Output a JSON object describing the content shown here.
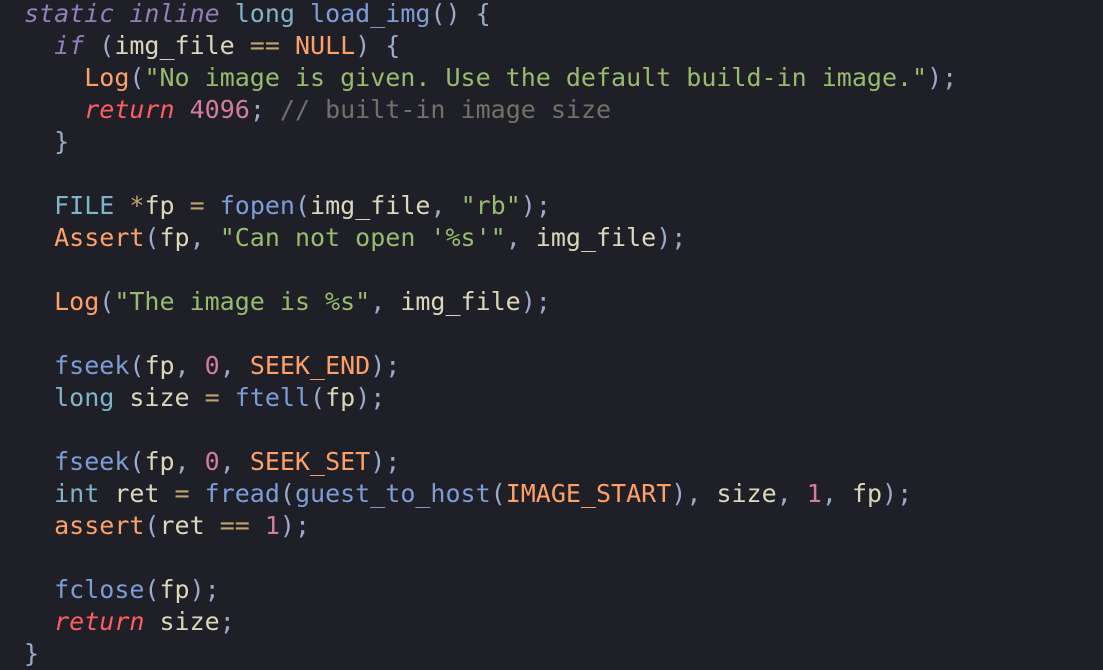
{
  "editor": {
    "lines": [
      {
        "tokens": [
          {
            "t": "static",
            "c": "kw-it"
          },
          {
            "t": " ",
            "c": "id"
          },
          {
            "t": "inline",
            "c": "kw-it"
          },
          {
            "t": " ",
            "c": "id"
          },
          {
            "t": "long",
            "c": "type"
          },
          {
            "t": " ",
            "c": "id"
          },
          {
            "t": "load_img",
            "c": "fn"
          },
          {
            "t": "()",
            "c": "punc"
          },
          {
            "t": " {",
            "c": "punc"
          }
        ]
      },
      {
        "tokens": [
          {
            "t": "  ",
            "c": "id"
          },
          {
            "t": "if",
            "c": "kw-it"
          },
          {
            "t": " (",
            "c": "punc"
          },
          {
            "t": "img_file",
            "c": "id"
          },
          {
            "t": " == ",
            "c": "op"
          },
          {
            "t": "NULL",
            "c": "const"
          },
          {
            "t": ") {",
            "c": "punc"
          }
        ]
      },
      {
        "tokens": [
          {
            "t": "    ",
            "c": "id"
          },
          {
            "t": "Log",
            "c": "log"
          },
          {
            "t": "(",
            "c": "punc"
          },
          {
            "t": "\"No image is given. Use the default build-in image.\"",
            "c": "str"
          },
          {
            "t": ");",
            "c": "punc"
          }
        ]
      },
      {
        "tokens": [
          {
            "t": "    ",
            "c": "id"
          },
          {
            "t": "return",
            "c": "ret"
          },
          {
            "t": " ",
            "c": "id"
          },
          {
            "t": "4096",
            "c": "num"
          },
          {
            "t": "; ",
            "c": "punc"
          },
          {
            "t": "// built-in image size",
            "c": "cmt"
          }
        ]
      },
      {
        "tokens": [
          {
            "t": "  ",
            "c": "id"
          },
          {
            "t": "}",
            "c": "punc"
          }
        ]
      },
      {
        "tokens": []
      },
      {
        "tokens": [
          {
            "t": "  ",
            "c": "id"
          },
          {
            "t": "FILE",
            "c": "type"
          },
          {
            "t": " ",
            "c": "id"
          },
          {
            "t": "*",
            "c": "op"
          },
          {
            "t": "fp",
            "c": "id"
          },
          {
            "t": " = ",
            "c": "op"
          },
          {
            "t": "fopen",
            "c": "fn"
          },
          {
            "t": "(",
            "c": "punc"
          },
          {
            "t": "img_file",
            "c": "id"
          },
          {
            "t": ", ",
            "c": "punc"
          },
          {
            "t": "\"rb\"",
            "c": "str"
          },
          {
            "t": ");",
            "c": "punc"
          }
        ]
      },
      {
        "tokens": [
          {
            "t": "  ",
            "c": "id"
          },
          {
            "t": "Assert",
            "c": "log"
          },
          {
            "t": "(",
            "c": "punc"
          },
          {
            "t": "fp",
            "c": "id"
          },
          {
            "t": ", ",
            "c": "punc"
          },
          {
            "t": "\"Can not open '%s'\"",
            "c": "str"
          },
          {
            "t": ", ",
            "c": "punc"
          },
          {
            "t": "img_file",
            "c": "id"
          },
          {
            "t": ");",
            "c": "punc"
          }
        ]
      },
      {
        "tokens": []
      },
      {
        "tokens": [
          {
            "t": "  ",
            "c": "id"
          },
          {
            "t": "Log",
            "c": "log"
          },
          {
            "t": "(",
            "c": "punc"
          },
          {
            "t": "\"The image is %s\"",
            "c": "str"
          },
          {
            "t": ", ",
            "c": "punc"
          },
          {
            "t": "img_file",
            "c": "id"
          },
          {
            "t": ");",
            "c": "punc"
          }
        ]
      },
      {
        "tokens": []
      },
      {
        "tokens": [
          {
            "t": "  ",
            "c": "id"
          },
          {
            "t": "fseek",
            "c": "fn"
          },
          {
            "t": "(",
            "c": "punc"
          },
          {
            "t": "fp",
            "c": "id"
          },
          {
            "t": ", ",
            "c": "punc"
          },
          {
            "t": "0",
            "c": "num"
          },
          {
            "t": ", ",
            "c": "punc"
          },
          {
            "t": "SEEK_END",
            "c": "const"
          },
          {
            "t": ");",
            "c": "punc"
          }
        ]
      },
      {
        "tokens": [
          {
            "t": "  ",
            "c": "id"
          },
          {
            "t": "long",
            "c": "type"
          },
          {
            "t": " size",
            "c": "id"
          },
          {
            "t": " = ",
            "c": "op"
          },
          {
            "t": "ftell",
            "c": "fn"
          },
          {
            "t": "(",
            "c": "punc"
          },
          {
            "t": "fp",
            "c": "id"
          },
          {
            "t": ");",
            "c": "punc"
          }
        ]
      },
      {
        "tokens": []
      },
      {
        "tokens": [
          {
            "t": "  ",
            "c": "id"
          },
          {
            "t": "fseek",
            "c": "fn"
          },
          {
            "t": "(",
            "c": "punc"
          },
          {
            "t": "fp",
            "c": "id"
          },
          {
            "t": ", ",
            "c": "punc"
          },
          {
            "t": "0",
            "c": "num"
          },
          {
            "t": ", ",
            "c": "punc"
          },
          {
            "t": "SEEK_SET",
            "c": "const"
          },
          {
            "t": ");",
            "c": "punc"
          }
        ]
      },
      {
        "tokens": [
          {
            "t": "  ",
            "c": "id"
          },
          {
            "t": "int",
            "c": "type"
          },
          {
            "t": " ret",
            "c": "id"
          },
          {
            "t": " = ",
            "c": "op"
          },
          {
            "t": "fread",
            "c": "fn"
          },
          {
            "t": "(",
            "c": "punc"
          },
          {
            "t": "guest_to_host",
            "c": "fn"
          },
          {
            "t": "(",
            "c": "punc"
          },
          {
            "t": "IMAGE_START",
            "c": "const"
          },
          {
            "t": "), ",
            "c": "punc"
          },
          {
            "t": "size",
            "c": "id"
          },
          {
            "t": ", ",
            "c": "punc"
          },
          {
            "t": "1",
            "c": "num"
          },
          {
            "t": ", ",
            "c": "punc"
          },
          {
            "t": "fp",
            "c": "id"
          },
          {
            "t": ");",
            "c": "punc"
          }
        ]
      },
      {
        "tokens": [
          {
            "t": "  ",
            "c": "id"
          },
          {
            "t": "assert",
            "c": "log"
          },
          {
            "t": "(",
            "c": "punc"
          },
          {
            "t": "ret",
            "c": "id"
          },
          {
            "t": " == ",
            "c": "op"
          },
          {
            "t": "1",
            "c": "num"
          },
          {
            "t": ");",
            "c": "punc"
          }
        ]
      },
      {
        "tokens": []
      },
      {
        "tokens": [
          {
            "t": "  ",
            "c": "id"
          },
          {
            "t": "fclose",
            "c": "fn"
          },
          {
            "t": "(",
            "c": "punc"
          },
          {
            "t": "fp",
            "c": "id"
          },
          {
            "t": ");",
            "c": "punc"
          }
        ]
      },
      {
        "tokens": [
          {
            "t": "  ",
            "c": "id"
          },
          {
            "t": "return",
            "c": "ret"
          },
          {
            "t": " size",
            "c": "id"
          },
          {
            "t": ";",
            "c": "punc"
          }
        ]
      },
      {
        "tokens": [
          {
            "t": "}",
            "c": "punc"
          }
        ]
      }
    ]
  }
}
